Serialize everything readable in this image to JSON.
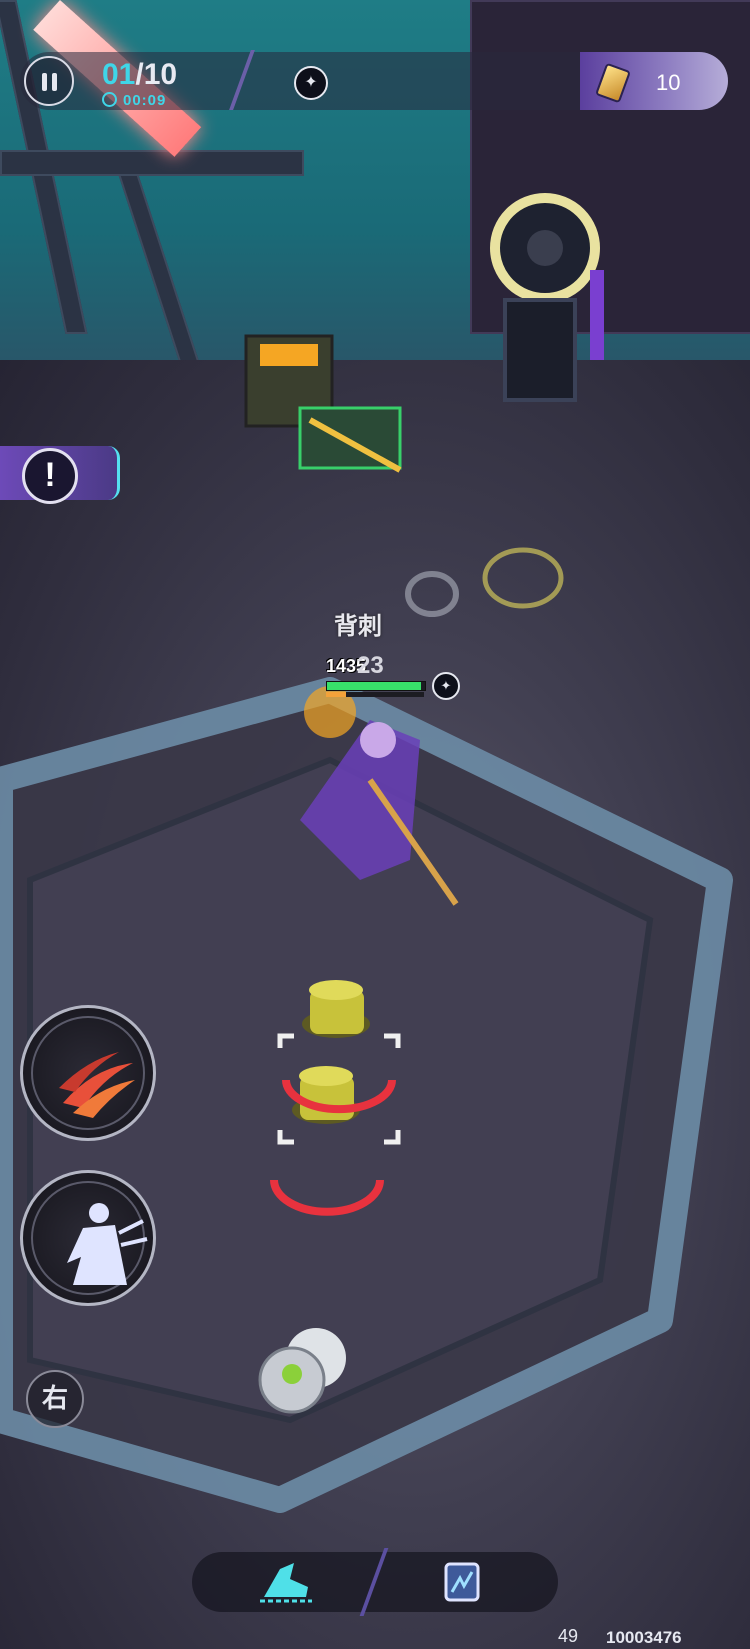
{
  "hud": {
    "wave_current": "01",
    "wave_total": "/10",
    "timer": "00:09",
    "currency": "10"
  },
  "combat": {
    "crit_label": "背刺",
    "hp_value": "1435",
    "damage": "23",
    "hp_fraction": 0.96,
    "energy_fraction": 0.2
  },
  "controls": {
    "switch_label": "右",
    "skills": [
      "slash-skill-icon",
      "dash-skill-icon"
    ],
    "bottom_items": [
      "speed-boots-icon",
      "card-icon"
    ]
  },
  "footer": {
    "fps": "49",
    "uid": "10003476"
  },
  "colors": {
    "accent_cyan": "#3fd6e8",
    "hp_green": "#38e06a",
    "energy_orange": "#f3a23a",
    "enemy_yellow": "#c8c23a",
    "danger_red": "#e8323e"
  }
}
